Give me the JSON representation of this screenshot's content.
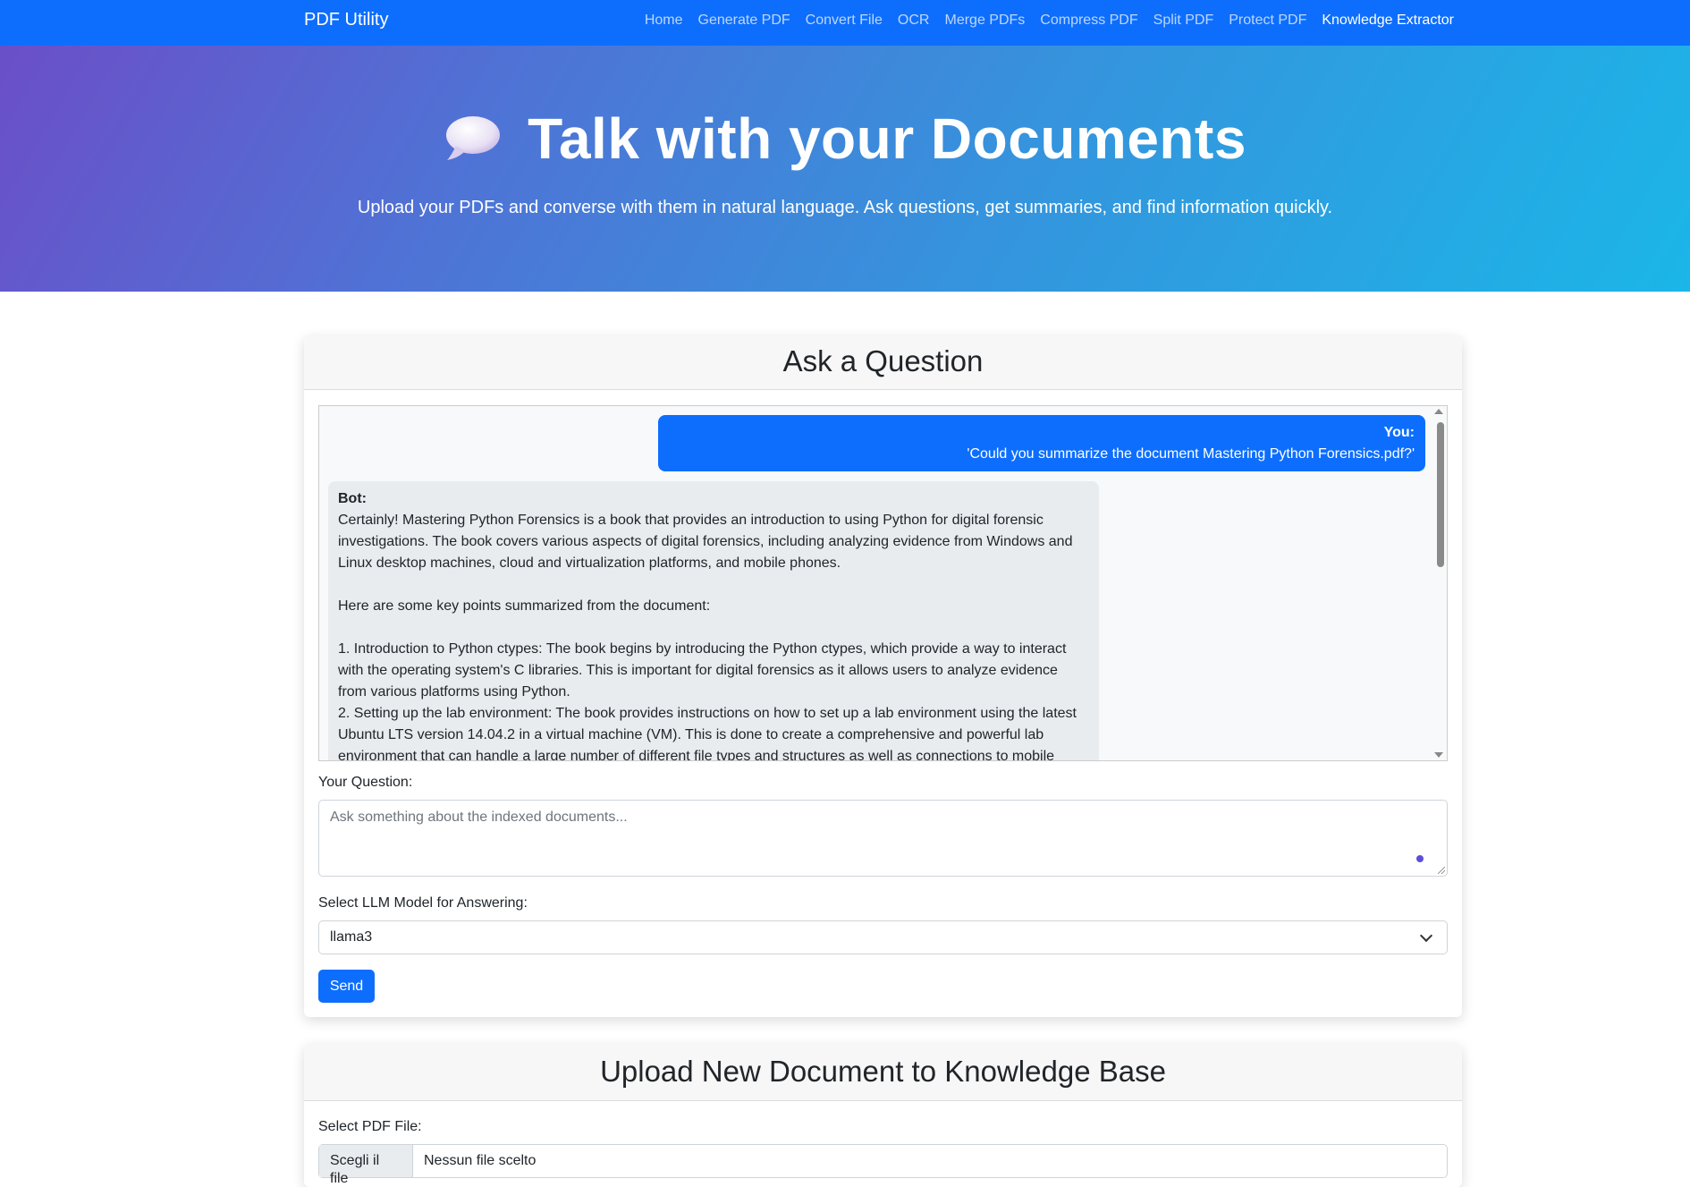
{
  "navbar": {
    "brand": "PDF Utility",
    "links": [
      "Home",
      "Generate PDF",
      "Convert File",
      "OCR",
      "Merge PDFs",
      "Compress PDF",
      "Split PDF",
      "Protect PDF",
      "Knowledge Extractor"
    ],
    "active_link": "Knowledge Extractor"
  },
  "hero": {
    "icon": "speech-balloon-icon",
    "title": "Talk with your Documents",
    "subtitle": "Upload your PDFs and converse with them in natural language. Ask questions, get summaries, and find information quickly."
  },
  "ask_card": {
    "title": "Ask a Question",
    "chat": {
      "user_label": "You:",
      "user_message": "'Could you summarize the document Mastering Python Forensics.pdf?'",
      "bot_label": "Bot:",
      "bot_lines": [
        "Certainly! Mastering Python Forensics is a book that provides an introduction to using Python for digital forensic",
        "investigations. The book covers various aspects of digital forensics, including analyzing evidence from Windows and",
        "Linux desktop machines, cloud and virtualization platforms, and mobile phones.",
        "",
        "Here are some key points summarized from the document:",
        "",
        "1. Introduction to Python ctypes: The book begins by introducing the Python ctypes, which provide a way to interact",
        "with the operating system's C libraries. This is important for digital forensics as it allows users to analyze evidence",
        "from various platforms using Python.",
        "2. Setting up the lab environment: The book provides instructions on how to set up a lab environment using the latest",
        "Ubuntu LTS version 14.04.2 in a virtual machine (VM). This is done to create a comprehensive and powerful lab",
        "environment that can handle a large number of different file types and structures as well as connections to mobile"
      ]
    },
    "question_label": "Your Question:",
    "question_placeholder": "Ask something about the indexed documents...",
    "model_label": "Select LLM Model for Answering:",
    "model_selected": "llama3",
    "send_label": "Send"
  },
  "upload_card": {
    "title": "Upload New Document to Knowledge Base",
    "file_label": "Select PDF File:",
    "file_button": "Scegli il file",
    "file_status": "Nessun file scelto"
  },
  "colors": {
    "primary": "#0d6efd",
    "hero_gradient_start": "#6b4fc8",
    "hero_gradient_end": "#1bb6e8",
    "bot_bubble": "#e9ecef"
  }
}
